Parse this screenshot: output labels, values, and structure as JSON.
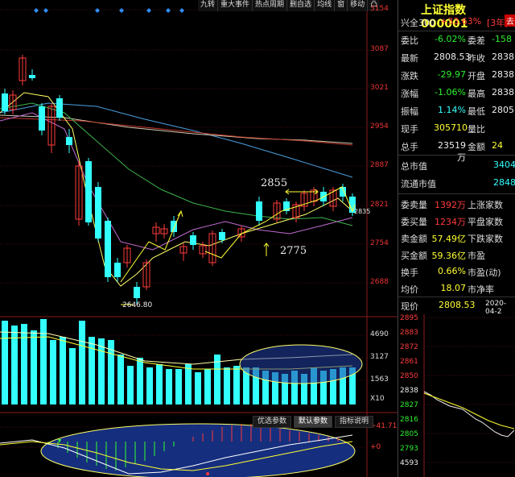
{
  "toolbar": [
    "九转",
    "重大事件",
    "热点周期",
    "删自选",
    "均线",
    "窗",
    "移动",
    "凸"
  ],
  "price_axis": [
    "3154",
    "3087",
    "3021",
    "2954",
    "2887",
    "2821",
    "2754",
    "2688"
  ],
  "vol_axis": [
    "4690",
    "3127",
    "1563",
    "X10"
  ],
  "macd_axis": [
    "+41.71",
    "+0"
  ],
  "chart_labels": {
    "low": "2646.80",
    "high_mark": "2855",
    "low_mark": "2775",
    "last": "2835"
  },
  "bottom_tabs": [
    "优选参数",
    "默认参数",
    "指标说明"
  ],
  "side": {
    "title": "上证指数 000001",
    "sub_left": "兴全300",
    "sub_change": "+33.63%",
    "sub_period": "[3年]",
    "sub_btn": "去",
    "rows": [
      {
        "l": "委比",
        "v1": "-6.02%",
        "c1": "green",
        "l2": "委差",
        "v2": "-158",
        "c2": "green"
      },
      {
        "l": "最新",
        "v1": "2808.53",
        "c1": "wht",
        "l2": "昨收",
        "v2": "2838",
        "c2": "wht"
      },
      {
        "l": "涨跌",
        "v1": "-29.97",
        "c1": "green",
        "l2": "开盘",
        "v2": "2838",
        "c2": "wht"
      },
      {
        "l": "涨幅",
        "v1": "-1.06%",
        "c1": "green",
        "l2": "最高",
        "v2": "2838",
        "c2": "wht"
      },
      {
        "l": "振幅",
        "v1": "1.14%",
        "c1": "cyan",
        "l2": "最低",
        "v2": "2805",
        "c2": "wht"
      },
      {
        "l": "现手",
        "v1": "305710",
        "c1": "yel",
        "l2": "量比",
        "v2": "",
        "c2": "wht"
      },
      {
        "l": "总手",
        "v1": "23519万",
        "c1": "wht",
        "l2": "金额",
        "v2": "24",
        "c2": "yel"
      }
    ],
    "rows2": [
      {
        "l": "总市值",
        "v": "3404",
        "c": "cyan"
      },
      {
        "l": "流通市值",
        "v": "2848",
        "c": "cyan"
      }
    ],
    "rows3": [
      {
        "l": "委卖量",
        "v1": "1392万",
        "c1": "red",
        "l2": "上涨家数",
        "v2": "",
        "c2": "red"
      },
      {
        "l": "委买量",
        "v1": "1234万",
        "c1": "red",
        "l2": "平盘家数",
        "v2": "",
        "c2": "wht"
      },
      {
        "l": "卖金额",
        "v1": "57.49亿",
        "c1": "yel",
        "l2": "下跌家数",
        "v2": "",
        "c2": "green"
      },
      {
        "l": "买金额",
        "v1": "59.36亿",
        "c1": "yel",
        "l2": "市盈",
        "v2": "",
        "c2": "wht"
      },
      {
        "l": "换手",
        "v1": "0.66%",
        "c1": "yel",
        "l2": "市盈(动)",
        "v2": "",
        "c2": "wht"
      },
      {
        "l": "均价",
        "v1": "18.07",
        "c1": "yel",
        "l2": "市净率",
        "v2": "",
        "c2": "wht"
      }
    ],
    "minute_header": {
      "label": "现价",
      "price": "2808.53",
      "date": "2020-04-2"
    },
    "minute_axis": [
      "2895",
      "2883",
      "2872",
      "2861",
      "2850",
      "2838",
      "2827",
      "2816",
      "2805",
      "2793",
      "4593"
    ]
  }
}
